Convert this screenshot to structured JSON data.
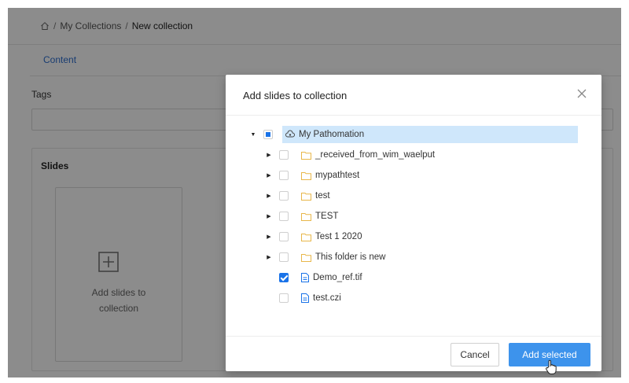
{
  "breadcrumb": {
    "separator": "/",
    "items": [
      "My Collections",
      "New collection"
    ]
  },
  "tabs": {
    "content": "Content"
  },
  "form": {
    "tags_label": "Tags",
    "tags_value": ""
  },
  "slides": {
    "title": "Slides",
    "add_line1": "Add slides to",
    "add_line2": "collection"
  },
  "modal": {
    "title": "Add slides to collection",
    "tree": {
      "root": {
        "label": "My Pathomation",
        "state": "indeterminate",
        "icon": "cloud-share-icon",
        "expanded": true
      },
      "folders": [
        {
          "label": "_received_from_wim_waelput",
          "checked": false
        },
        {
          "label": "mypathtest",
          "checked": false
        },
        {
          "label": "test",
          "checked": false
        },
        {
          "label": "TEST",
          "checked": false
        },
        {
          "label": "Test 1 2020",
          "checked": false
        },
        {
          "label": "This folder is new",
          "checked": false
        }
      ],
      "files": [
        {
          "label": "Demo_ref.tif",
          "checked": true
        },
        {
          "label": "test.czi",
          "checked": false
        }
      ]
    },
    "cancel_label": "Cancel",
    "add_label": "Add selected"
  },
  "colors": {
    "accent": "#3d93ec",
    "link": "#2f6fcf",
    "tree_highlight": "#cfe7fb",
    "folder_icon": "#f2c94c",
    "file_icon": "#1a73e8"
  }
}
